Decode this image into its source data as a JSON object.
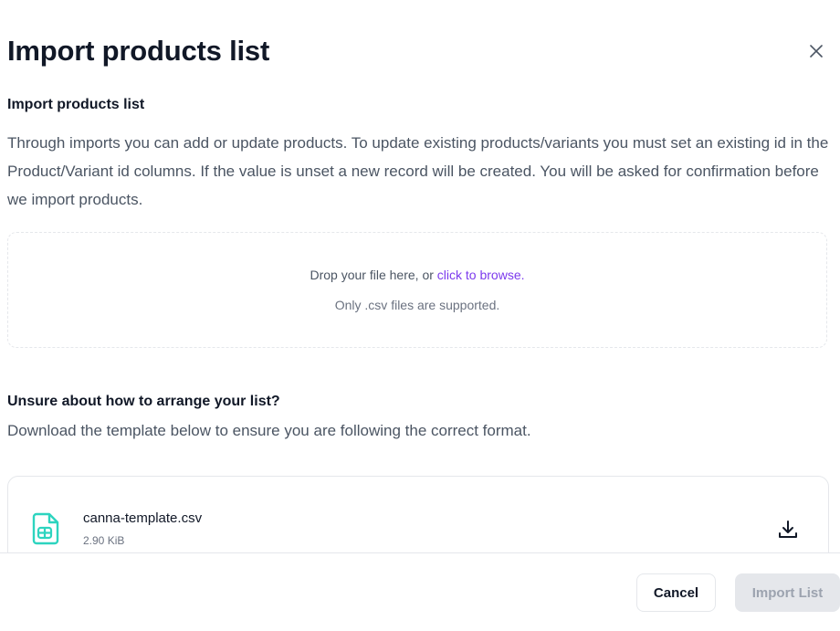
{
  "modal": {
    "title": "Import products list",
    "close_icon": "close-icon"
  },
  "import_section": {
    "heading": "Import products list",
    "description": "Through imports you can add or update products. To update existing products/variants you must set an existing id in the Product/Variant id columns. If the value is unset a new record will be created. You will be asked for confirmation before we import products."
  },
  "dropzone": {
    "prompt_prefix": "Drop your file here, or ",
    "browse_link": "click to browse.",
    "supported_note": "Only .csv files are supported."
  },
  "template_section": {
    "heading": "Unsure about how to arrange your list?",
    "description": "Download the template below to ensure you are following the correct format."
  },
  "template_file": {
    "name": "canna-template.csv",
    "size": "2.90 KiB",
    "icon": "spreadsheet-file-icon",
    "download_icon": "download-icon"
  },
  "footer": {
    "cancel_label": "Cancel",
    "import_label": "Import List"
  },
  "colors": {
    "link": "#7c3aed",
    "file_icon": "#2dd4bf",
    "disabled_bg": "#e5e7eb"
  }
}
